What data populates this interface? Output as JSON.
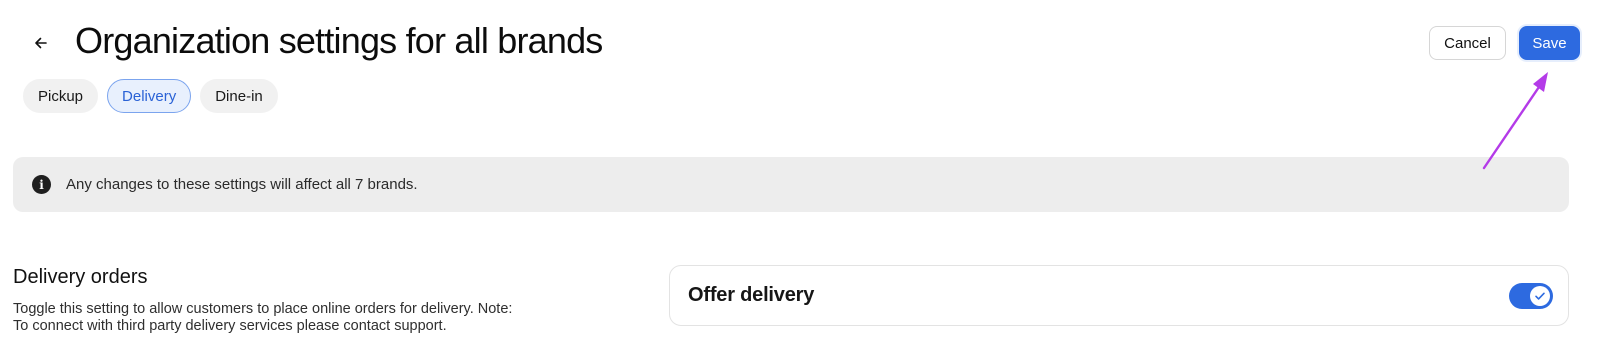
{
  "header": {
    "title": "Organization settings for all brands",
    "back_icon": "arrow-left-icon",
    "cancel_label": "Cancel",
    "save_label": "Save"
  },
  "tabs": [
    {
      "label": "Pickup",
      "active": false
    },
    {
      "label": "Delivery",
      "active": true
    },
    {
      "label": "Dine-in",
      "active": false
    }
  ],
  "banner": {
    "icon": "info-icon",
    "text": "Any changes to these settings will affect all 7 brands."
  },
  "delivery_orders": {
    "title": "Delivery orders",
    "description": "Toggle this setting to allow customers to place online orders for delivery. Note: To connect with third party delivery services please contact support.",
    "offer_delivery": {
      "label": "Offer delivery",
      "enabled": true
    }
  },
  "colors": {
    "accent": "#2d6ae0",
    "annotation": "#b43be8",
    "banner_bg": "#ededed"
  }
}
